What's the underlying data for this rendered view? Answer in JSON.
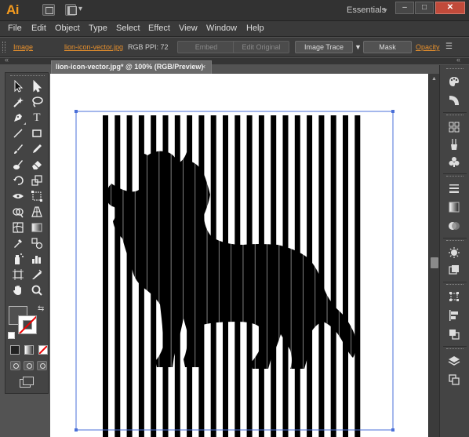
{
  "app": {
    "logo": "Ai",
    "workspace": "Essentials",
    "window_controls": {
      "minimize": "–",
      "maximize": "□",
      "close": "✕"
    }
  },
  "menu": {
    "items": [
      "File",
      "Edit",
      "Object",
      "Type",
      "Select",
      "Effect",
      "View",
      "Window",
      "Help"
    ]
  },
  "control_bar": {
    "object_type": "Image",
    "file_link": "lion-icon-vector.jpg",
    "color_mode": "RGB",
    "ppi": "PPI: 72",
    "embed_label": "Embed",
    "edit_original_label": "Edit Original",
    "image_trace_label": "Image Trace",
    "mask_label": "Mask",
    "opacity_label": "Opacity"
  },
  "document": {
    "tab_title": "lion-icon-vector.jpg* @ 100% (RGB/Preview)",
    "close_glyph": "×"
  },
  "toolbar": {
    "tools": [
      "selection-tool",
      "direct-selection-tool",
      "magic-wand-tool",
      "lasso-tool",
      "pen-tool",
      "type-tool",
      "line-segment-tool",
      "rectangle-tool",
      "paintbrush-tool",
      "pencil-tool",
      "blob-brush-tool",
      "eraser-tool",
      "rotate-tool",
      "scale-tool",
      "width-tool",
      "free-transform-tool",
      "shape-builder-tool",
      "perspective-grid-tool",
      "mesh-tool",
      "gradient-tool",
      "eyedropper-tool",
      "blend-tool",
      "symbol-sprayer-tool",
      "column-graph-tool",
      "artboard-tool",
      "slice-tool",
      "hand-tool",
      "zoom-tool"
    ],
    "type_glyph": "T"
  },
  "right_dock": {
    "panels": [
      "color-panel",
      "color-guide-panel",
      "swatches-panel",
      "brushes-panel",
      "symbols-panel",
      "stroke-panel",
      "gradient-panel",
      "transparency-panel",
      "appearance-panel",
      "graphic-styles-panel",
      "transform-panel",
      "align-panel",
      "pathfinder-panel",
      "layers-panel",
      "artboards-panel"
    ]
  },
  "colors": {
    "accent_orange": "#e8902c",
    "selection_blue": "#4a6fd8",
    "artwork_black": "#000000",
    "close_red": "#c14a3a"
  }
}
